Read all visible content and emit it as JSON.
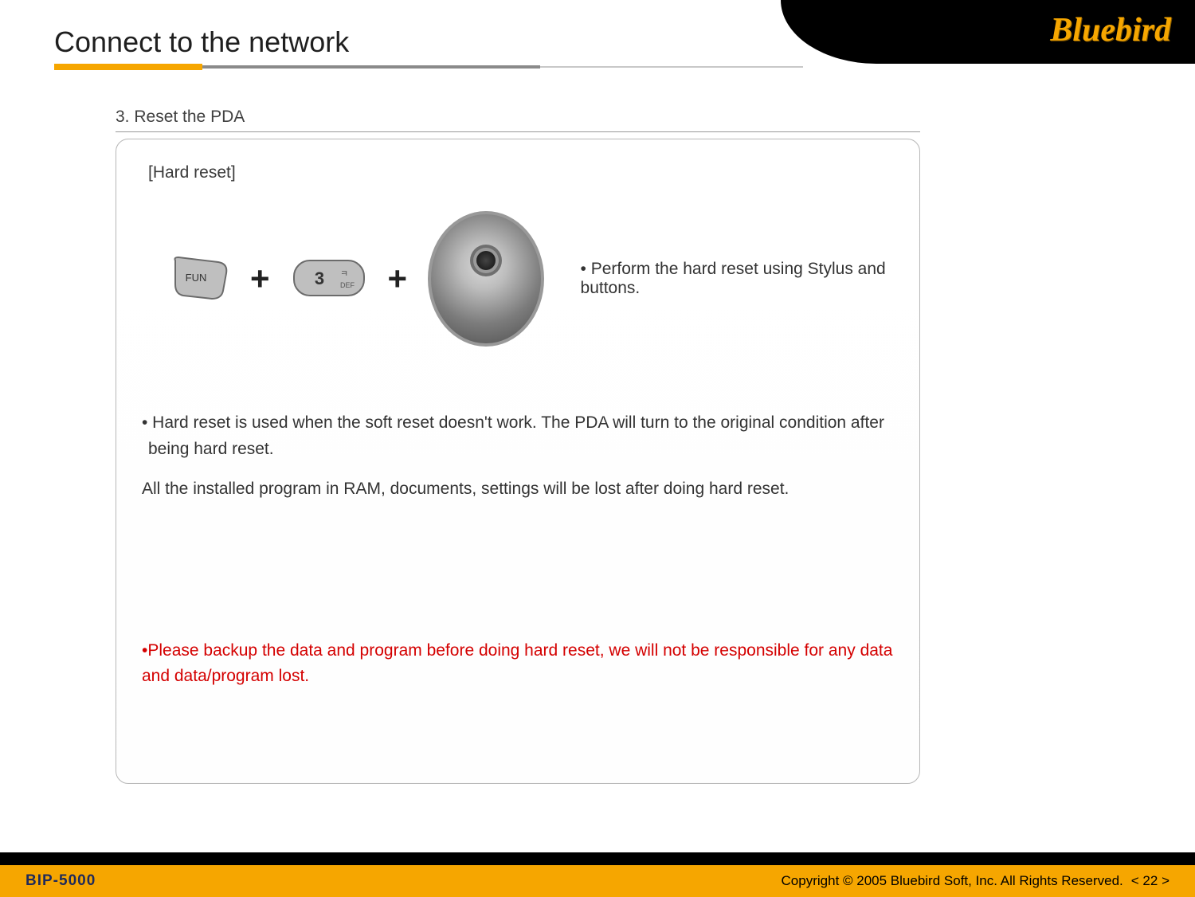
{
  "header": {
    "title": "Connect to the network",
    "brand": "Bluebird"
  },
  "section": {
    "heading": "3. Reset the PDA",
    "subtitle": "[Hard reset]",
    "illustration": {
      "key1_label": "FUN",
      "plus": "+",
      "key2_label": "3",
      "right_text": "• Perform the hard reset using Stylus and buttons."
    },
    "para1": "• Hard reset is used when the soft reset doesn't work.  The PDA will turn to the original condition after",
    "para1b": " being hard reset.",
    "para2": "All the installed program in RAM, documents, settings will be lost after doing hard reset.",
    "warning_a": "•Please backup the data and program before doing hard reset, we will not be responsible for any data",
    "warning_b": "and data/program lost."
  },
  "footer": {
    "model": "BIP-5000",
    "copyright": "Copyright © 2005 Bluebird Soft, Inc. All Rights Reserved.",
    "page": "< 22 >"
  }
}
